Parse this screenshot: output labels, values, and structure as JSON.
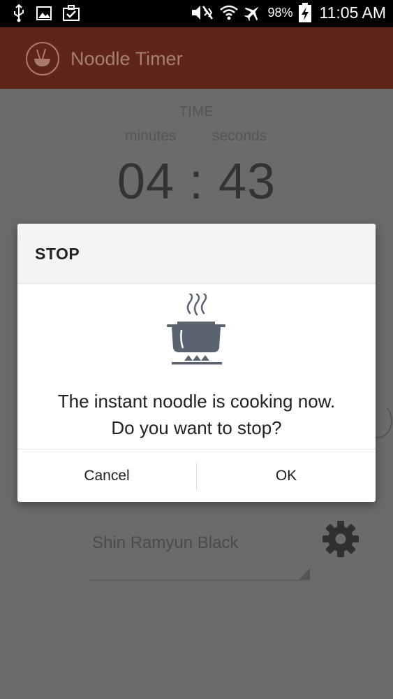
{
  "status_bar": {
    "battery_percent": "98%",
    "time": "11:05 AM",
    "icons": [
      "usb-icon",
      "gallery-icon",
      "task-icon",
      "mute-icon",
      "wifi-icon",
      "airplane-icon",
      "battery-charging-icon"
    ]
  },
  "app_bar": {
    "title": "Noodle Timer",
    "logo_icon": "noodle-bowl-icon"
  },
  "timer": {
    "label": "TIME",
    "minutes_label": "minutes",
    "seconds_label": "seconds",
    "display": "04 : 43"
  },
  "noodle": {
    "selected": "Shin Ramyun Black",
    "settings_icon": "gear-icon"
  },
  "dialog": {
    "title": "STOP",
    "icon": "cooking-pot-icon",
    "message_line1": "The instant noodle is cooking now.",
    "message_line2": "Do you want to stop?",
    "cancel_label": "Cancel",
    "ok_label": "OK"
  },
  "colors": {
    "app_bar": "#5f2519",
    "overlay_bg": "#6b6b6b",
    "dialog_icon": "#5a6370"
  }
}
